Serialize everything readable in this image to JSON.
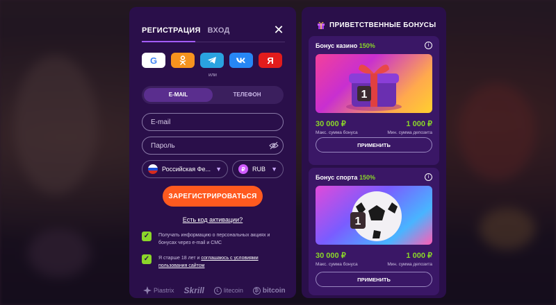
{
  "auth": {
    "tab_register": "РЕГИСТРАЦИЯ",
    "tab_login": "ВХОД",
    "social": {
      "google": "G",
      "ok": "ok",
      "telegram": "tg",
      "vk": "vk",
      "yandex": "Я"
    },
    "or_label": "или",
    "mode_email": "E-MAIL",
    "mode_phone": "ТЕЛЕФОН",
    "email_placeholder": "E-mail",
    "password_placeholder": "Пароль",
    "country": "Российская Фе...",
    "currency": "RUB",
    "currency_symbol": "₽",
    "register_button": "ЗАРЕГИСТРИРОВАТЬСЯ",
    "promo_link": "Есть код активации?",
    "consent_promo": "Получать информацию о персональных акциях и бонусах через e-mail и СМС",
    "consent_age_prefix": "Я старше 18 лет и ",
    "consent_age_link": "соглашаюсь с условиями пользования сайтом",
    "payments": [
      "Piastrix",
      "Skrill",
      "litecoin",
      "bitcoin"
    ]
  },
  "bonuses": {
    "title": "ПРИВЕТСТВЕННЫЕ БОНУСЫ",
    "casino": {
      "name": "Бонус казино",
      "percent": "150%",
      "max_bonus": "30 000 ₽",
      "min_deposit": "1 000 ₽",
      "max_label": "Макс. сумма бонуса",
      "min_label": "Мин. сумма депозита",
      "apply": "ПРИМЕНИТЬ"
    },
    "sport": {
      "name": "Бонус спорта",
      "percent": "150%",
      "max_bonus": "30 000 ₽",
      "min_deposit": "1 000 ₽",
      "max_label": "Макс. сумма бонуса",
      "min_label": "Мин. сумма депозита",
      "apply": "ПРИМЕНИТЬ"
    }
  },
  "colors": {
    "panel_bg": "#2a0f4a",
    "accent_orange": "#ff5a1f",
    "accent_green": "#8bd62a",
    "accent_purple": "#a45cff"
  }
}
